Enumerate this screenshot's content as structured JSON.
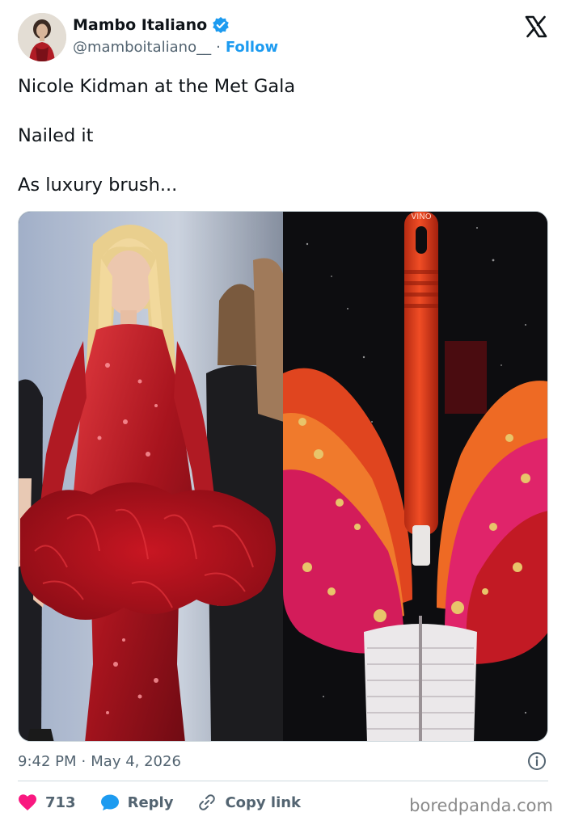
{
  "author": {
    "display_name": "Mambo Italiano",
    "handle": "@mamboitaliano__",
    "separator": "·",
    "follow_label": "Follow",
    "verified": true
  },
  "tweet": {
    "lines": [
      "Nicole Kidman at the Met Gala",
      "Nailed it",
      "As luxury brush..."
    ]
  },
  "media": {
    "left_image": "woman in red sequined feathered gown",
    "right_image": "red bottle brush with orange and pink feathers",
    "brush_label": "VINO"
  },
  "meta": {
    "time": "9:42 PM",
    "separator": "·",
    "date": "May 4, 2026"
  },
  "actions": {
    "like_count": "713",
    "reply_label": "Reply",
    "copy_link_label": "Copy link"
  },
  "watermark": "boredpanda.com",
  "colors": {
    "accent": "#1d9bf0",
    "like": "#f91880",
    "text": "#0f1419",
    "secondary": "#536471"
  }
}
